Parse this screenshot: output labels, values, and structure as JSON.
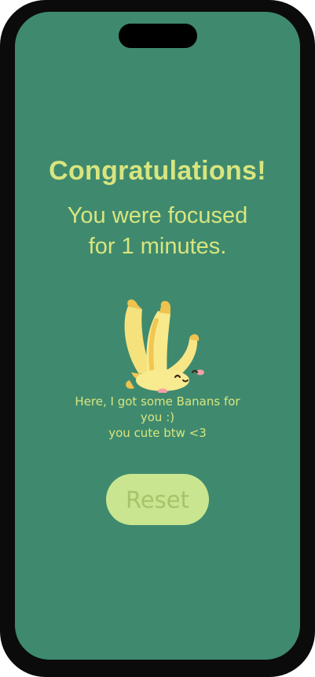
{
  "congrats": {
    "title": "Congratulations!",
    "line1": "You were focused",
    "line2": "for 1 minutes."
  },
  "illustration": {
    "icon": "banana-bunch-icon"
  },
  "note": {
    "line1": "Here, I got some Banans for",
    "line2": "you :)",
    "line3": "you cute btw <3"
  },
  "actions": {
    "reset_label": "Reset"
  },
  "colors": {
    "screen_bg": "#3f8a6e",
    "text": "#d8e57f",
    "button_bg": "#c9e58f",
    "button_text": "#a7c46a",
    "frame": "#0b0b0b"
  }
}
